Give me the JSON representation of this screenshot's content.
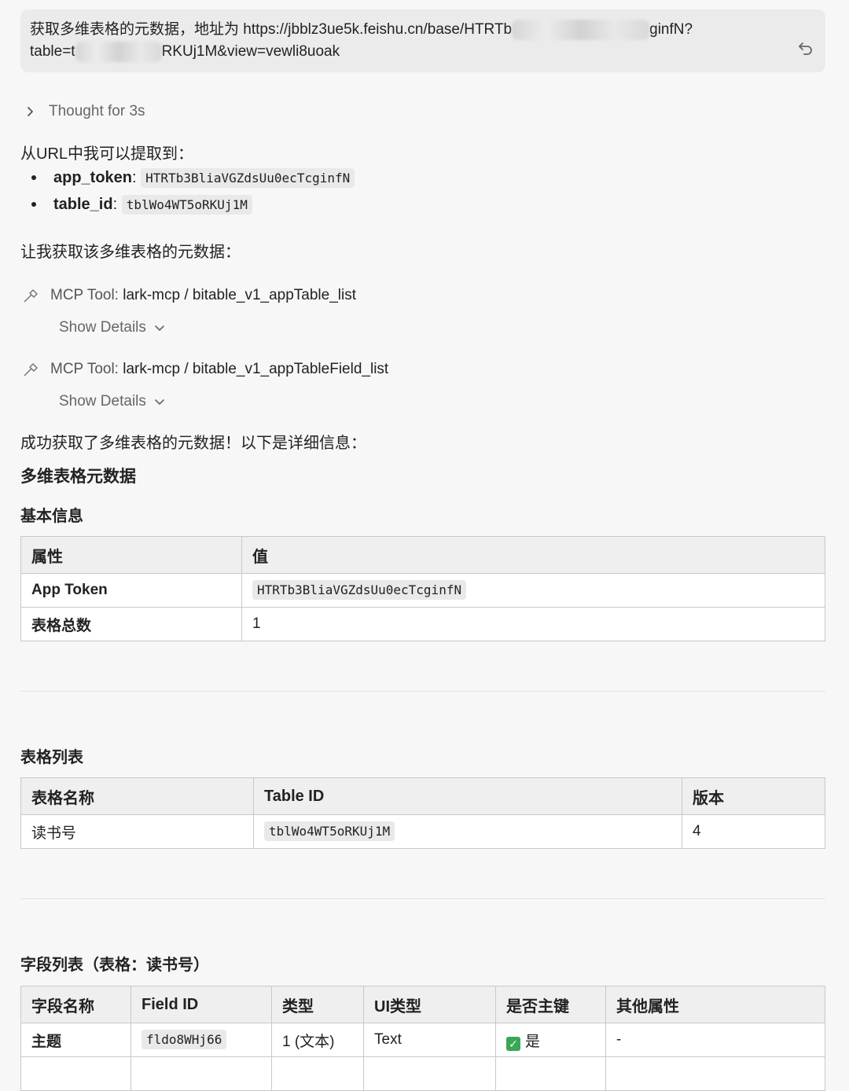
{
  "user_message": {
    "line1_prefix": "获取多维表格的元数据，地址为 https://jbblz3ue5k.feishu.cn/base/HTRTb",
    "line1_suffix": "ginfN?",
    "line2_prefix": "table=t",
    "line2_suffix": "RKUj1M&view=vewli8uoak"
  },
  "thought": "Thought for 3s",
  "intro": "从URL中我可以提取到：",
  "extracted": [
    {
      "key": "app_token",
      "value": "HTRTb3BliaVGZdsUu0ecTcginfN"
    },
    {
      "key": "table_id",
      "value": "tblWo4WT5oRKUj1M"
    }
  ],
  "next_step": "让我获取该多维表格的元数据：",
  "tools": [
    {
      "prefix": "MCP Tool:",
      "name": "lark-mcp / bitable_v1_appTable_list",
      "details": "Show Details"
    },
    {
      "prefix": "MCP Tool:",
      "name": "lark-mcp / bitable_v1_appTableField_list",
      "details": "Show Details"
    }
  ],
  "success": "成功获取了多维表格的元数据！以下是详细信息：",
  "h_metadata": "多维表格元数据",
  "h_basic": "基本信息",
  "basic_table": {
    "headers": [
      "属性",
      "值"
    ],
    "rows": [
      [
        "App Token",
        "HTRTb3BliaVGZdsUu0ecTcginfN"
      ],
      [
        "表格总数",
        "1"
      ]
    ]
  },
  "h_tables": "表格列表",
  "tables_table": {
    "headers": [
      "表格名称",
      "Table ID",
      "版本"
    ],
    "rows": [
      [
        "读书号",
        "tblWo4WT5oRKUj1M",
        "4"
      ]
    ]
  },
  "h_fields": "字段列表（表格：读书号）",
  "fields_table": {
    "headers": [
      "字段名称",
      "Field ID",
      "类型",
      "UI类型",
      "是否主键",
      "其他属性"
    ],
    "rows": [
      [
        "主题",
        "fldo8WHj66",
        "1 (文本)",
        "Text",
        "是",
        "-"
      ]
    ]
  }
}
